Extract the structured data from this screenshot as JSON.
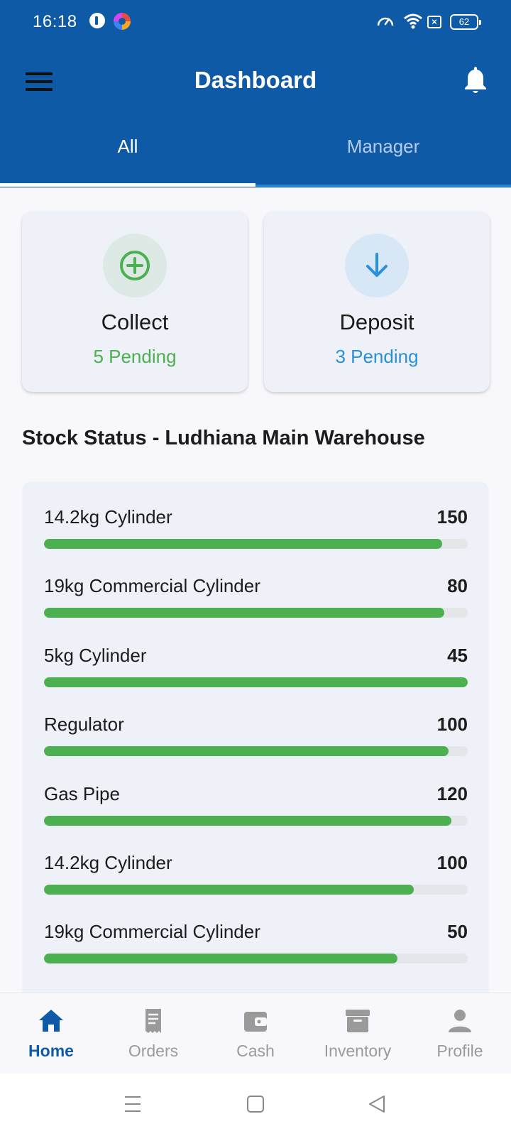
{
  "status_bar": {
    "time": "16:18",
    "battery": "62",
    "sim_glyph": "×"
  },
  "header": {
    "title": "Dashboard",
    "menu_icon": "hamburger-menu-icon",
    "notification_icon": "bell-icon",
    "background": "#0e5aa7"
  },
  "tabs": [
    {
      "label": "All",
      "active": true
    },
    {
      "label": "Manager",
      "active": false
    }
  ],
  "cards": {
    "collect": {
      "title": "Collect",
      "subtitle": "5 Pending",
      "icon": "plus-circle-icon",
      "color": "#4caf50"
    },
    "deposit": {
      "title": "Deposit",
      "subtitle": "3 Pending",
      "icon": "arrow-down-icon",
      "color": "#2b8fd9"
    }
  },
  "stock": {
    "title": "Stock Status - Ludhiana Main Warehouse",
    "items": [
      {
        "name": "14.2kg Cylinder",
        "qty": "150",
        "level": 0.94
      },
      {
        "name": "19kg Commercial Cylinder",
        "qty": "80",
        "level": 0.945
      },
      {
        "name": "5kg Cylinder",
        "qty": "45",
        "level": 1.0
      },
      {
        "name": "Regulator",
        "qty": "100",
        "level": 0.955
      },
      {
        "name": "Gas Pipe",
        "qty": "120",
        "level": 0.962
      },
      {
        "name": "14.2kg Cylinder",
        "qty": "100",
        "level": 0.872
      },
      {
        "name": "19kg Commercial Cylinder",
        "qty": "50",
        "level": 0.834
      }
    ],
    "bar_color": "#4caf50"
  },
  "bottom_nav": [
    {
      "label": "Home",
      "icon": "home-icon",
      "active": true
    },
    {
      "label": "Orders",
      "icon": "receipt-icon",
      "active": false
    },
    {
      "label": "Cash",
      "icon": "wallet-icon",
      "active": false
    },
    {
      "label": "Inventory",
      "icon": "archive-box-icon",
      "active": false
    },
    {
      "label": "Profile",
      "icon": "person-icon",
      "active": false
    }
  ]
}
